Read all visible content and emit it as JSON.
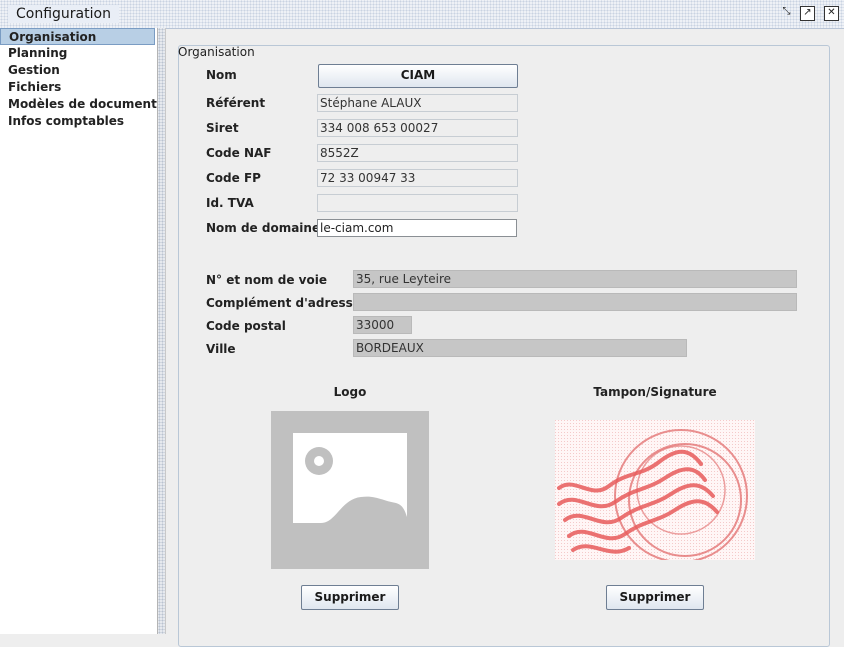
{
  "window": {
    "title": "Configuration"
  },
  "sidebar": {
    "items": [
      {
        "label": "Organisation"
      },
      {
        "label": "Planning"
      },
      {
        "label": "Gestion"
      },
      {
        "label": "Fichiers"
      },
      {
        "label": "Modèles de document"
      },
      {
        "label": "Infos comptables"
      }
    ],
    "selected_index": 0
  },
  "organisation": {
    "legend": "Organisation",
    "nom": {
      "label": "Nom",
      "value": "CIAM"
    },
    "referent": {
      "label": "Référent",
      "value": "Stéphane ALAUX"
    },
    "siret": {
      "label": "Siret",
      "value": "334 008 653 00027"
    },
    "code_naf": {
      "label": "Code NAF",
      "value": "8552Z"
    },
    "code_fp": {
      "label": "Code FP",
      "value": "72 33 00947 33"
    },
    "id_tva": {
      "label": "Id. TVA",
      "value": ""
    },
    "nom_domaine": {
      "label": "Nom de domaine",
      "value": "le-ciam.com"
    },
    "voie": {
      "label": "N° et nom de voie",
      "value": "35, rue Leyteire"
    },
    "complement": {
      "label": "Complément d'adresse",
      "value": ""
    },
    "code_postal": {
      "label": "Code postal",
      "value": "33000"
    },
    "ville": {
      "label": "Ville",
      "value": "BORDEAUX"
    },
    "logo": {
      "label": "Logo",
      "delete_label": "Supprimer"
    },
    "tampon": {
      "label": "Tampon/Signature",
      "delete_label": "Supprimer"
    }
  },
  "colors": {
    "selection": "#b8cfe5",
    "stamp": "#e85c5c"
  }
}
